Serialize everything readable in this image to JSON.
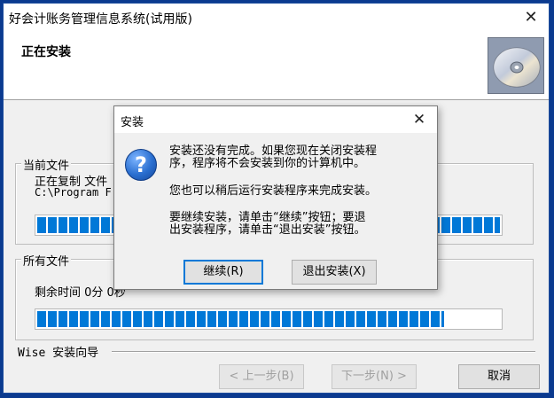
{
  "main_window": {
    "title": "好会计账务管理信息系统(试用版)",
    "close_symbol": "✕",
    "header_title": "正在安装",
    "header_icon": "cd-disc-icon",
    "current_file": {
      "group_label": "当前文件",
      "status_text": "正在复制 文件",
      "path_text": "C:\\Program F",
      "progress_percent": 100
    },
    "all_files": {
      "group_label": "所有文件",
      "remaining_time": "剩余时间 0分 0秒",
      "progress_percent": 88
    },
    "wise_label": "Wise 安装向导",
    "buttons": {
      "back": "< 上一步(B)",
      "next": "下一步(N) >",
      "cancel": "取消"
    }
  },
  "dialog": {
    "title": "安装",
    "close_symbol": "✕",
    "icon": "question-icon",
    "icon_glyph": "?",
    "message_lines": [
      "安装还没有完成。如果您现在关闭安装程",
      "序，程序将不会安装到你的计算机中。",
      "您也可以稍后运行安装程序来完成安装。",
      "要继续安装，请单击“继续”按钮；要退",
      "出安装程序，请单击“退出安装”按钮。"
    ],
    "buttons": {
      "continue": "继续(R)",
      "exit": "退出安装(X)"
    }
  },
  "colors": {
    "desktop": "#0b3a8f",
    "progress_fill": "#0078d7",
    "default_button_border": "#0078d7"
  }
}
